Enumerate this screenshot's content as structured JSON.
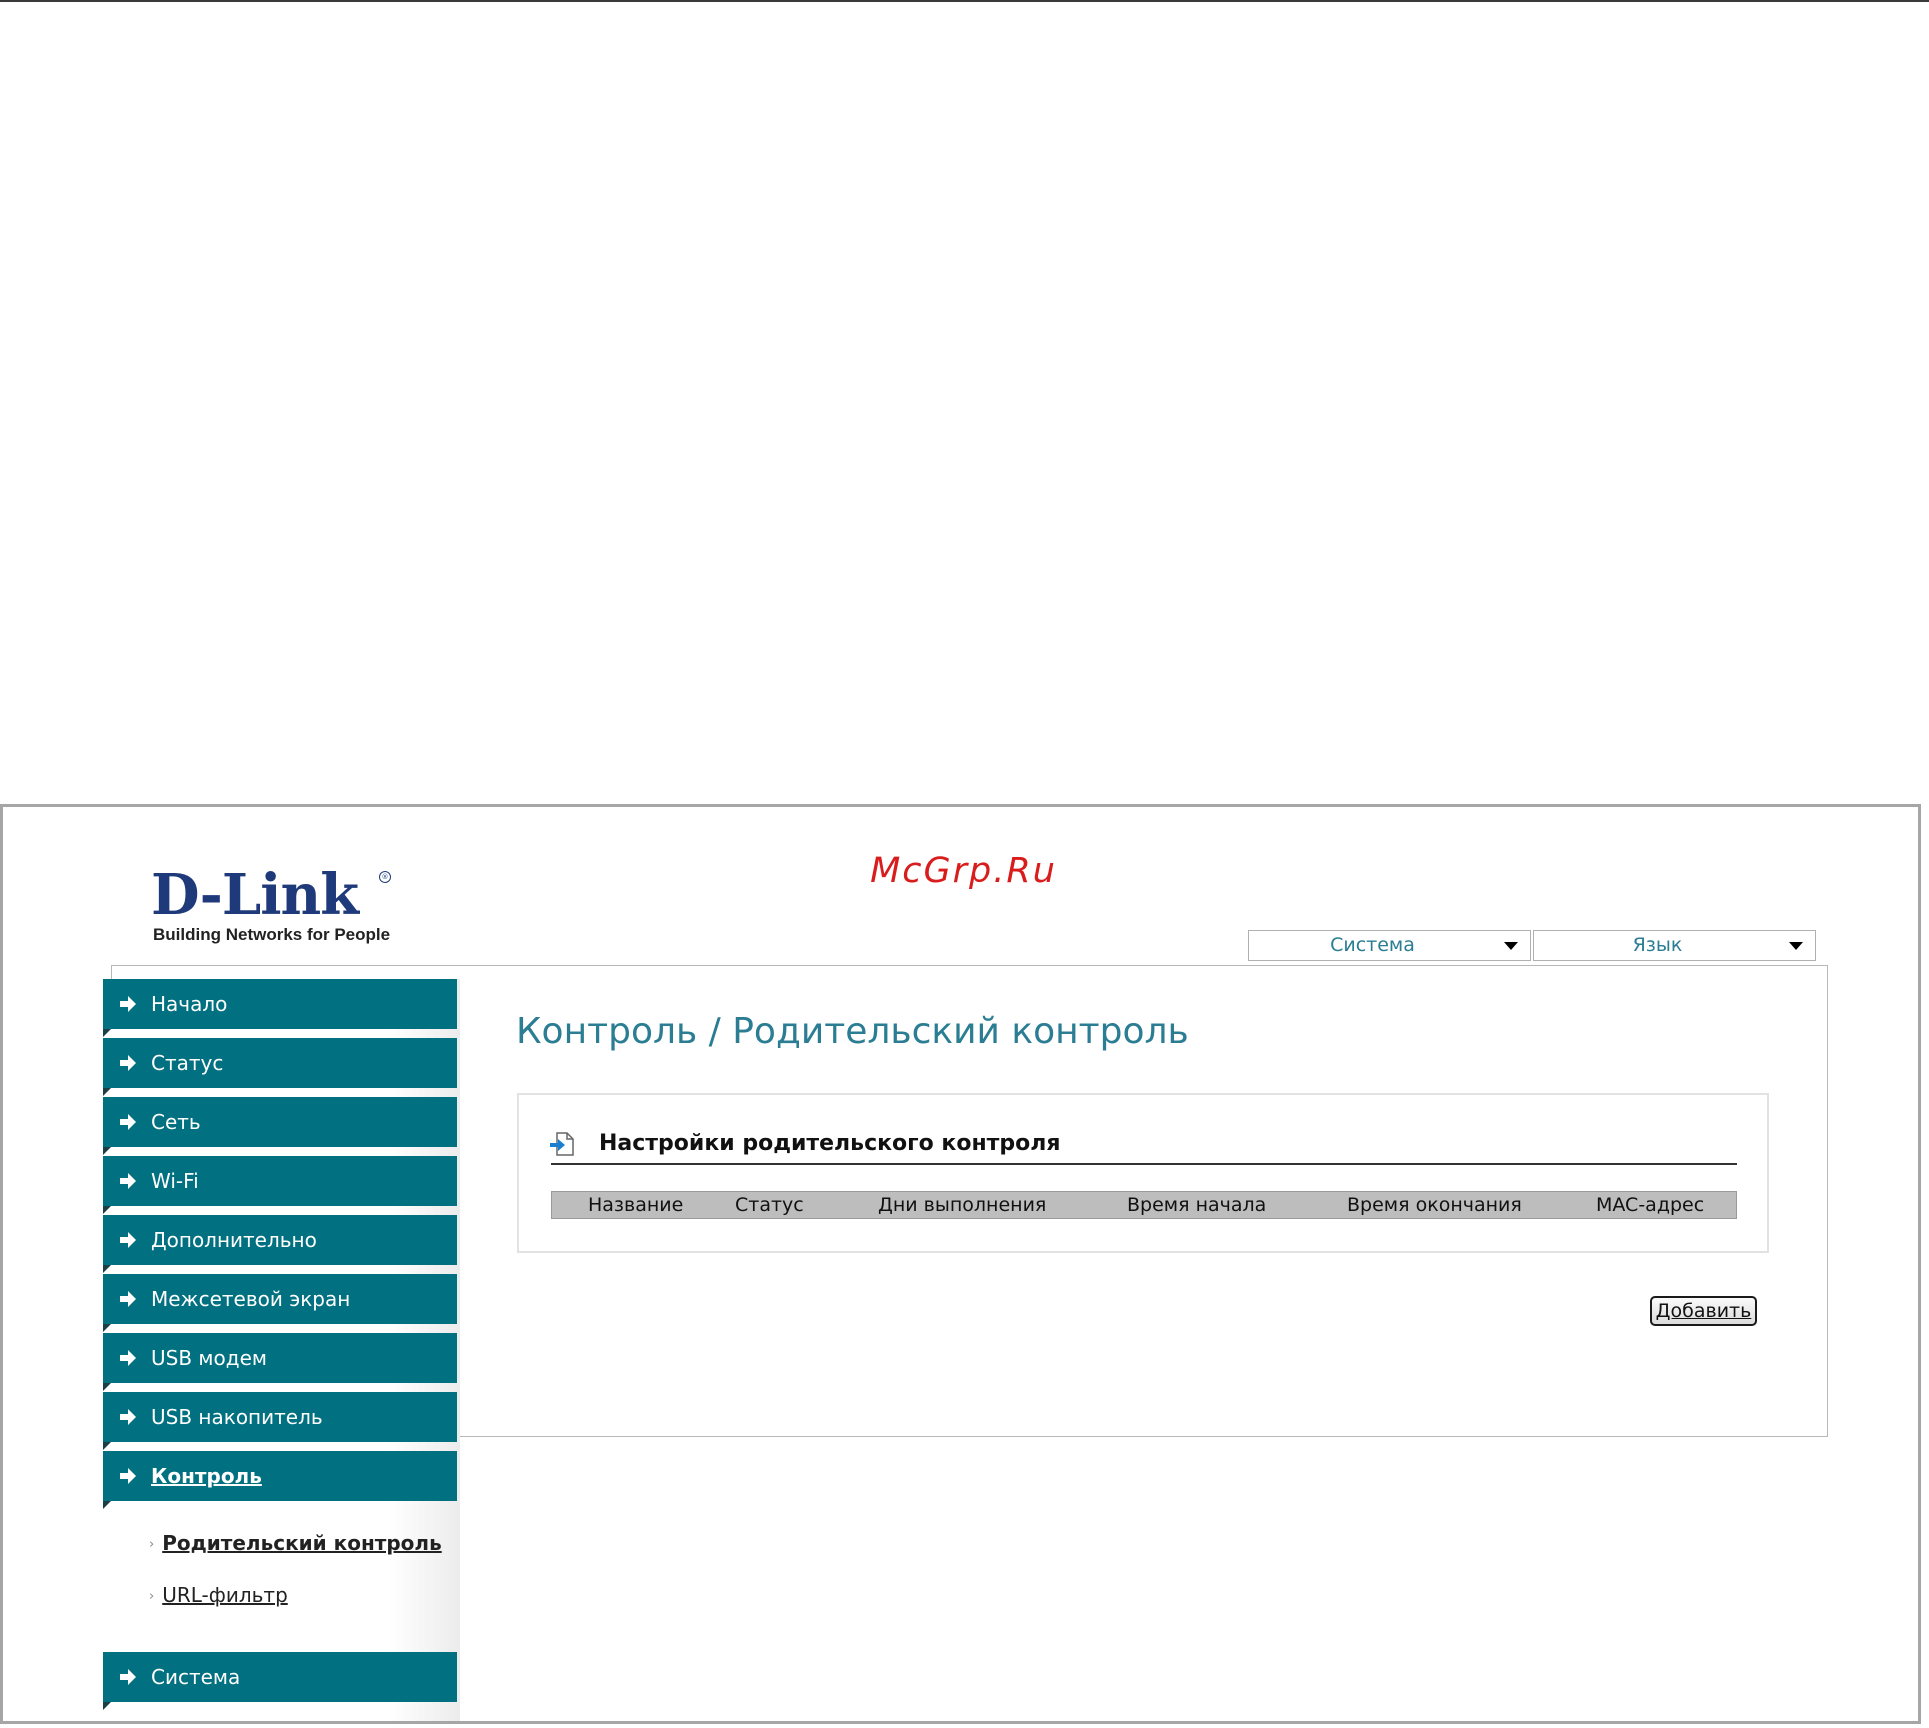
{
  "watermark": "McGrp.Ru",
  "logo": {
    "main": "D-Link",
    "registered": "®",
    "tagline": "Building Networks for People"
  },
  "top_menus": {
    "system": "Система",
    "language": "Язык"
  },
  "sidebar": {
    "items": [
      {
        "label": "Начало"
      },
      {
        "label": "Статус"
      },
      {
        "label": "Сеть"
      },
      {
        "label": "Wi-Fi"
      },
      {
        "label": "Дополнительно"
      },
      {
        "label": "Межсетевой экран"
      },
      {
        "label": "USB модем"
      },
      {
        "label": "USB накопитель"
      },
      {
        "label": "Контроль",
        "active": true
      },
      {
        "label": "Система"
      }
    ],
    "subitems": [
      {
        "label": "Родительский контроль",
        "active": true
      },
      {
        "label": "URL-фильтр"
      }
    ],
    "bullet": "›"
  },
  "main": {
    "page_title": "Контроль /  Родительский контроль",
    "section_title": "Настройки родительского контроля",
    "table_columns": [
      "Название",
      "Статус",
      "Дни выполнения",
      "Время начала",
      "Время окончания",
      "MAC-адрес"
    ],
    "table_rows": [],
    "add_button": "Добавить"
  },
  "colors": {
    "nav_background": "#017080",
    "title_color": "#2a7d92",
    "watermark_color": "#d91c1c",
    "logo_color": "#1f3a7a"
  },
  "icons": {
    "nav_arrow": "arrow-right-icon",
    "section": "document-arrow-icon",
    "dropdown": "chevron-down-icon"
  }
}
